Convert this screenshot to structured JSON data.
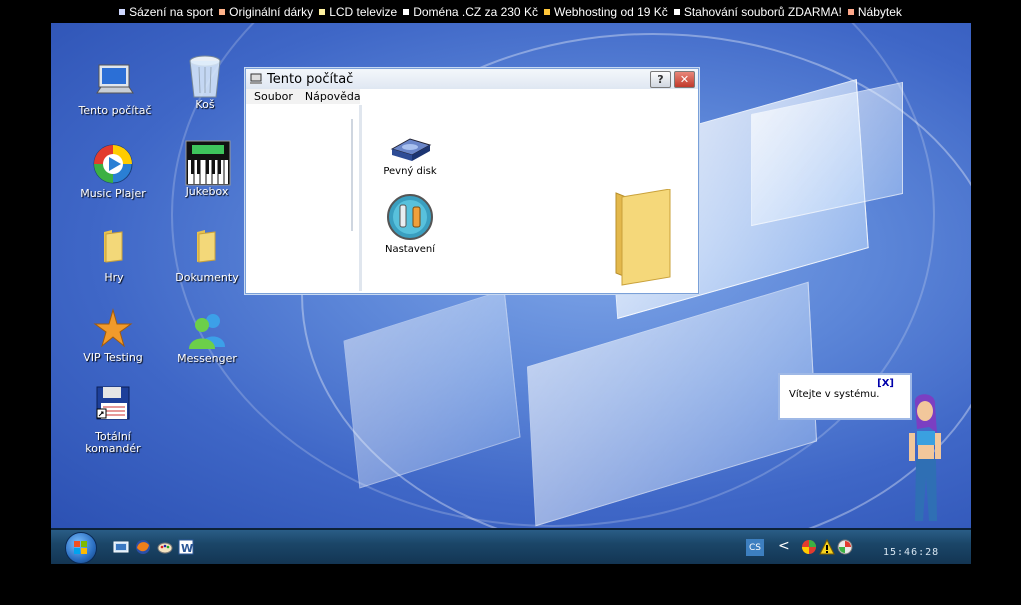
{
  "ad_bar": {
    "items": [
      {
        "label": "Sázení na sport",
        "color": "#cfd8ff"
      },
      {
        "label": "Originální dárky",
        "color": "#ffb38a"
      },
      {
        "label": "LCD televize",
        "color": "#fff2a0"
      },
      {
        "label": "Doména .CZ za 230 Kč",
        "color": "#ffffff"
      },
      {
        "label": "Webhosting od 19 Kč",
        "color": "#ffc63a"
      },
      {
        "label": "Stahování souborů ZDARMA!",
        "color": "#ffffff"
      },
      {
        "label": "Nábytek",
        "color": "#ffa88a"
      }
    ]
  },
  "desktop": {
    "icons": [
      {
        "label": "Tento počítač",
        "icon": "computer-icon"
      },
      {
        "label": "Koš",
        "icon": "recycle-bin-icon"
      },
      {
        "label": "Music Plajer",
        "icon": "media-player-icon"
      },
      {
        "label": "Jukebox",
        "icon": "keyboard-icon"
      },
      {
        "label": "Hry",
        "icon": "folder-icon"
      },
      {
        "label": "Dokumenty",
        "icon": "folder-icon"
      },
      {
        "label": "VIP Testing",
        "icon": "star-icon"
      },
      {
        "label": "Messenger",
        "icon": "messenger-icon"
      },
      {
        "label": "Totální komandér",
        "icon": "floppy-icon"
      }
    ]
  },
  "window": {
    "title": "Tento počítač",
    "help_label": "?",
    "close_label": "✕",
    "menu": [
      "Soubor",
      "Nápověda"
    ],
    "items": [
      {
        "label": "Pevný disk",
        "icon": "hard-disk-icon"
      },
      {
        "label": "Nastavení",
        "icon": "settings-icon"
      }
    ]
  },
  "notification": {
    "close_label": "[X]",
    "message": "Vítejte v systému."
  },
  "taskbar": {
    "lang": "CS",
    "chevron": "<",
    "clock": "15:46:28"
  }
}
